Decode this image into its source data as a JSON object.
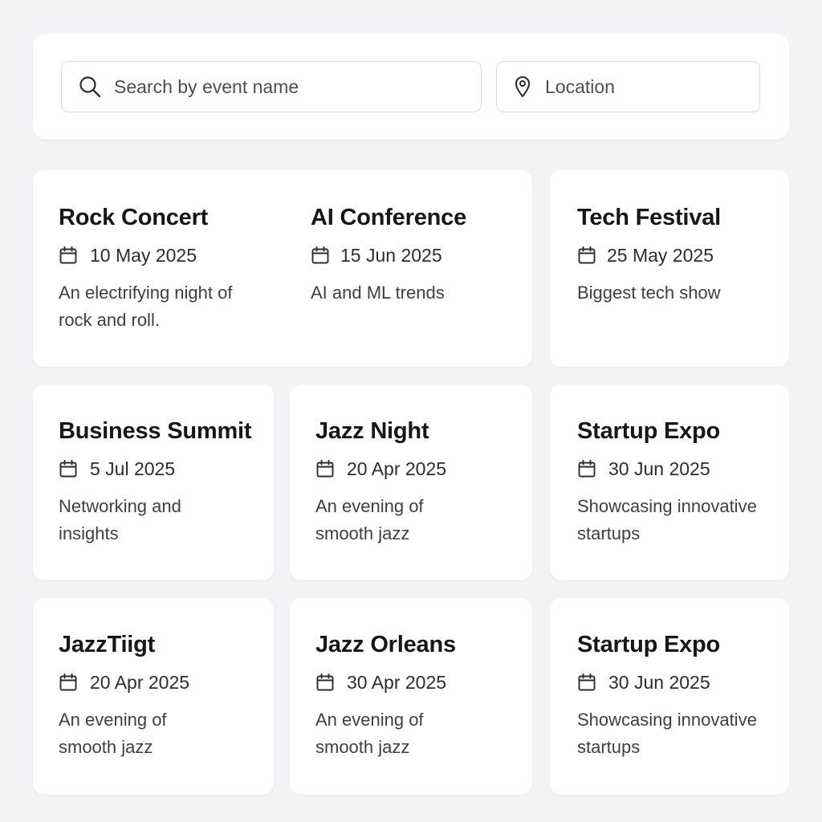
{
  "search": {
    "placeholder": "Search by event name",
    "icon": "search-icon"
  },
  "location": {
    "placeholder": "Location",
    "icon": "map-pin-icon"
  },
  "calendar_icon": "calendar-icon",
  "events": [
    {
      "title": "Rock Concert",
      "date": "10 May 2025",
      "description": "An electrifying night of rock and roll."
    },
    {
      "title": "AI Conference",
      "date": "15 Jun 2025",
      "description": "AI and ML trends"
    },
    {
      "title": "Tech Festival",
      "date": "25 May 2025",
      "description": "Biggest tech show"
    },
    {
      "title": "Business Summit",
      "date": "5 Jul 2025",
      "description": "Networking and insights"
    },
    {
      "title": "Jazz Night",
      "date": "20 Apr 2025",
      "description": "An evening of smooth jazz"
    },
    {
      "title": "Startup Expo",
      "date": "30 Jun 2025",
      "description": "Showcasing innovative startups"
    },
    {
      "title": "JazzTiigt",
      "date": "20 Apr 2025",
      "description": "An evening of smooth jazz"
    },
    {
      "title": "Jazz Orleans",
      "date": "30 Apr 2025",
      "description": "An evening of smooth jazz"
    },
    {
      "title": "Startup Expo",
      "date": "30 Jun 2025",
      "description": "Showcasing innovative startups"
    }
  ]
}
